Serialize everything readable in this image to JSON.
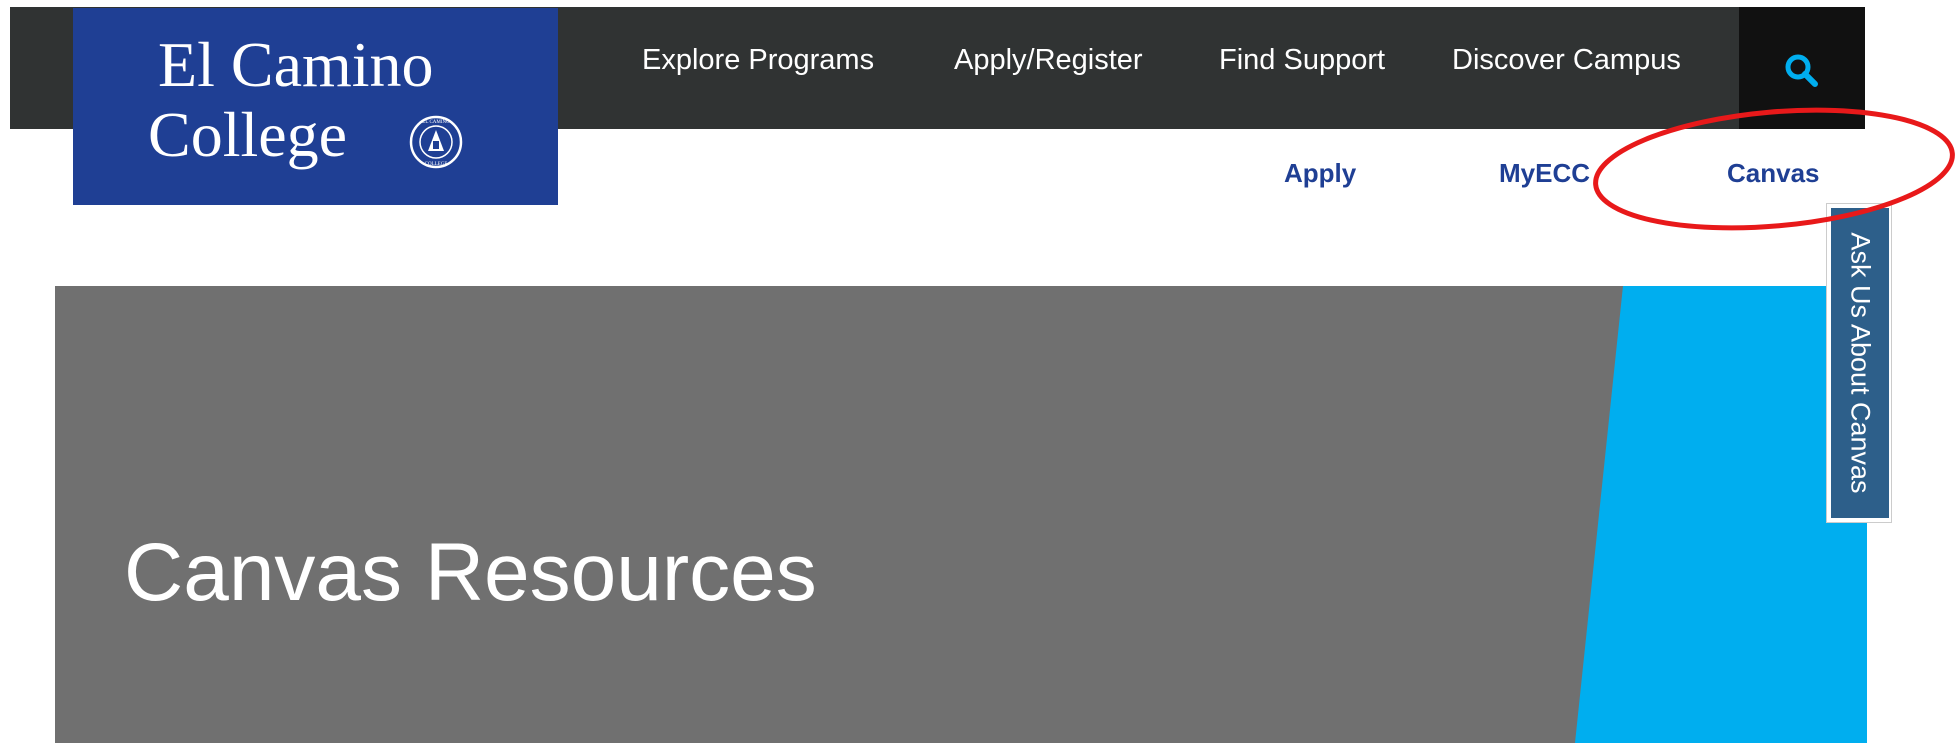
{
  "logo": {
    "line1": "El Camino",
    "line2": "College",
    "seal_text_top": "EL CAMINO",
    "seal_text_bottom": "COLLEGE"
  },
  "main_nav": [
    {
      "label": "Explore Programs"
    },
    {
      "label": "Apply/Register"
    },
    {
      "label": "Find Support"
    },
    {
      "label": "Discover Campus"
    }
  ],
  "search": {
    "icon": "search-icon"
  },
  "secondary_nav": [
    {
      "label": "Apply"
    },
    {
      "label": "MyECC"
    },
    {
      "label": "Canvas"
    }
  ],
  "hero": {
    "title": "Canvas Resources"
  },
  "ask_tab": {
    "label": "Ask Us About Canvas"
  },
  "colors": {
    "topbar": "#303333",
    "logo_bg": "#1f3f94",
    "link": "#1f3f94",
    "hero_bg": "#707070",
    "hero_accent": "#00aeef",
    "annotation": "#e8191a",
    "ask_tab_bg": "#2d5f8a"
  }
}
